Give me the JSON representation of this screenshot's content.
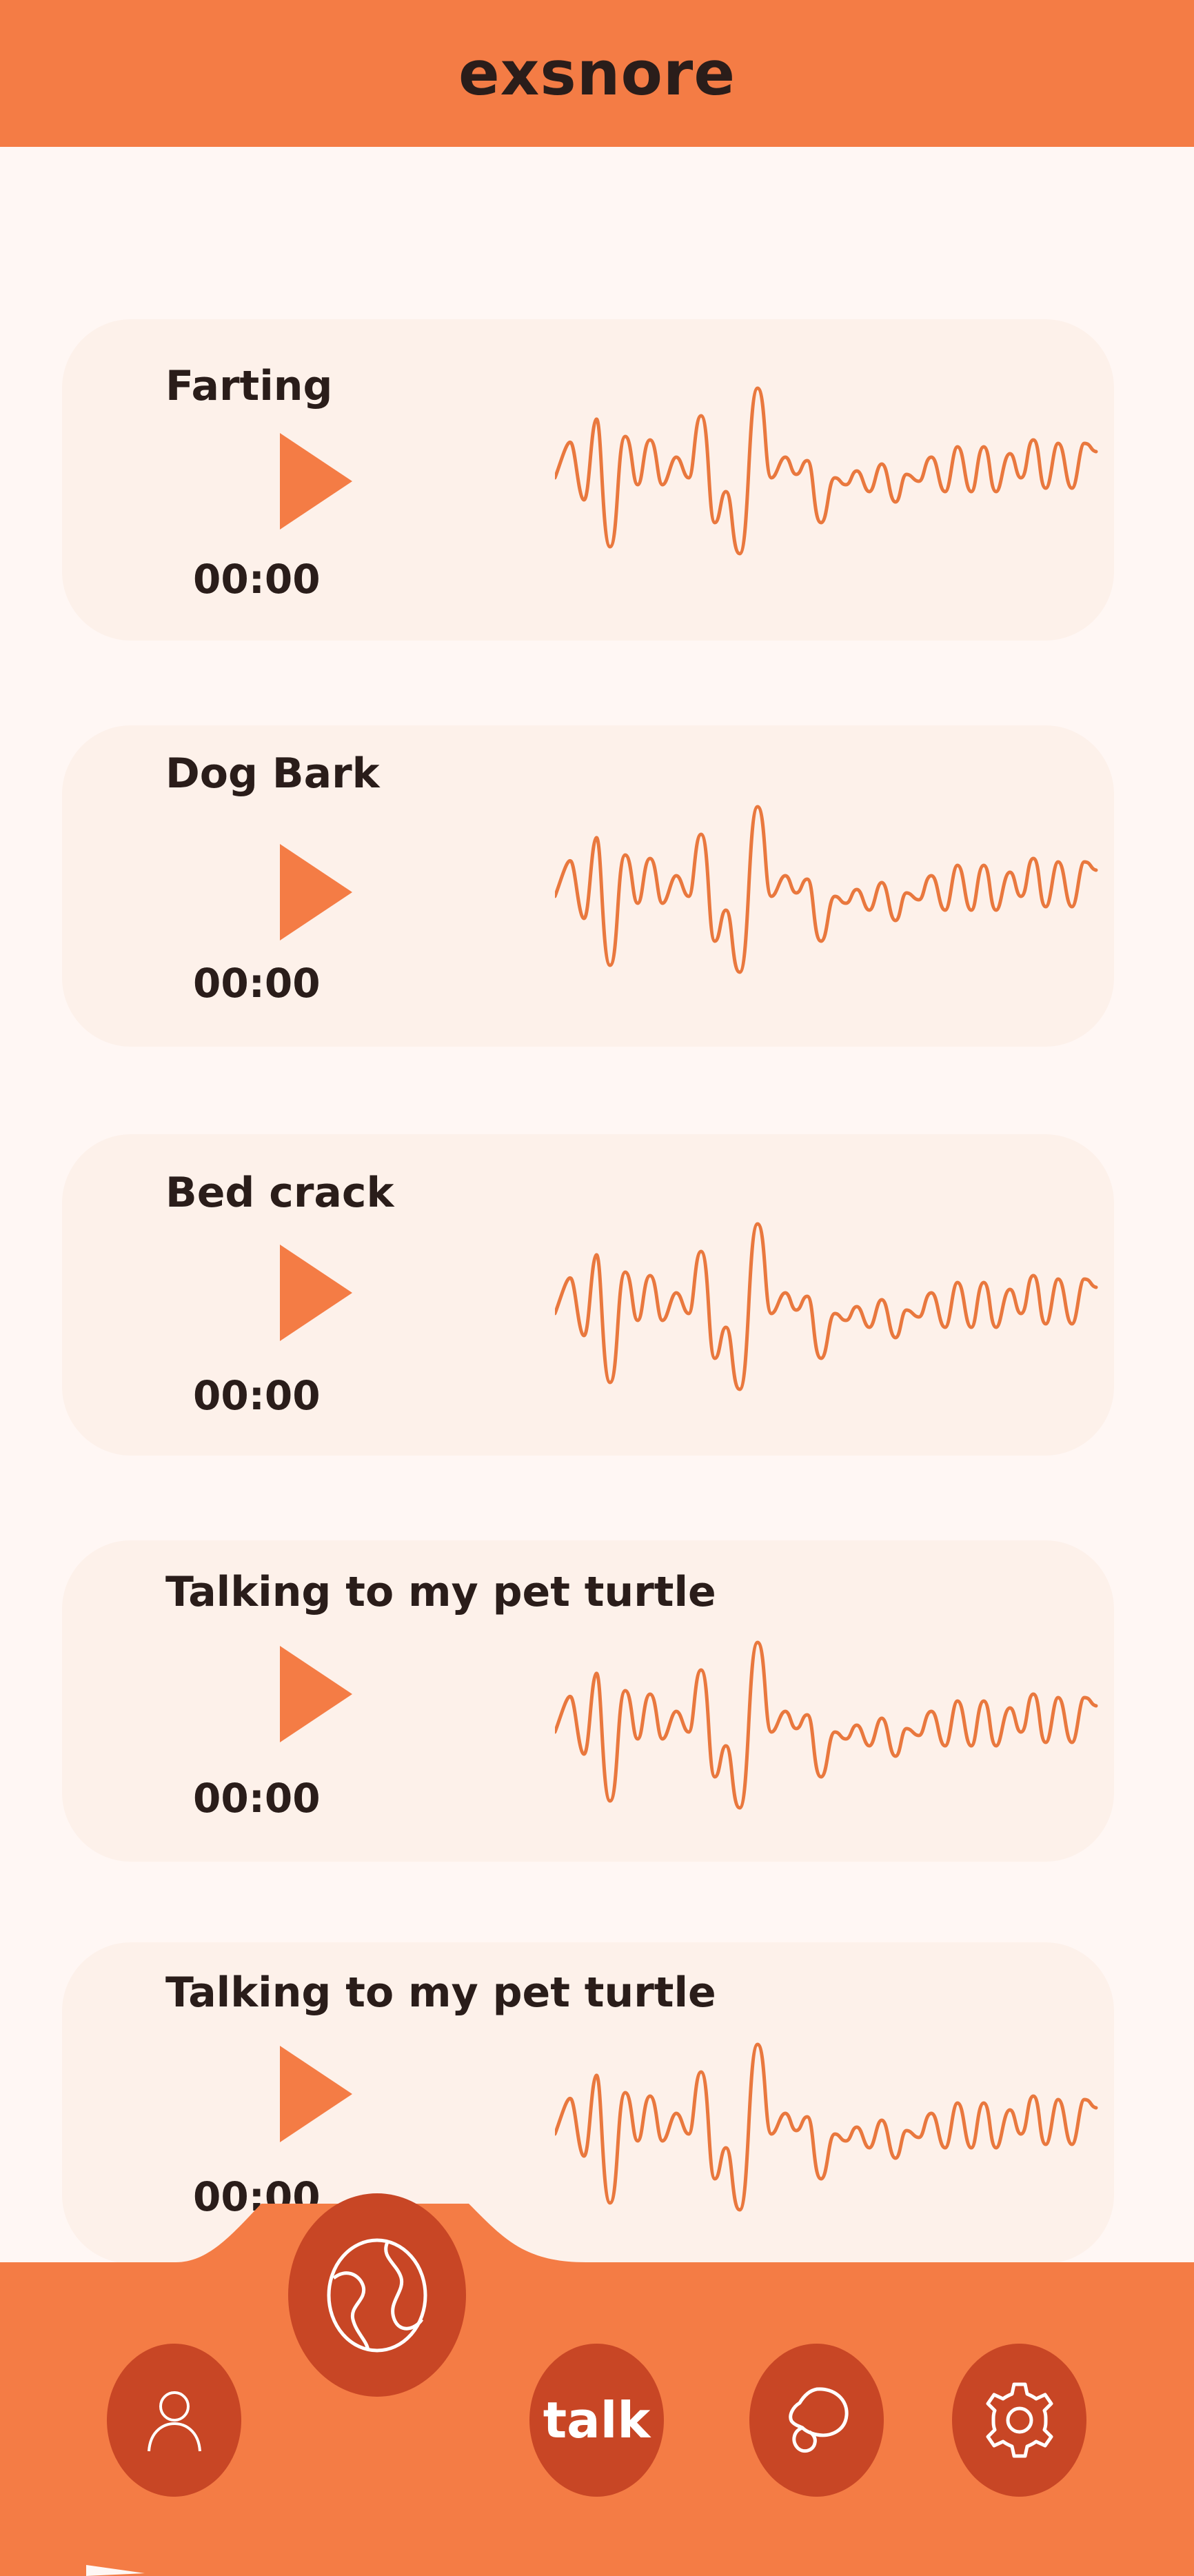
{
  "app": {
    "title": "exsnore"
  },
  "recordings": [
    {
      "title": "Farting",
      "time": "00:00"
    },
    {
      "title": "Dog Bark",
      "time": "00:00"
    },
    {
      "title": "Bed crack",
      "time": "00:00"
    },
    {
      "title": "Talking to my pet turtle",
      "time": "00:00"
    },
    {
      "title": "Talking to my pet turtle",
      "time": "00:00"
    }
  ],
  "icons": {
    "play": "play-icon",
    "waveform": "waveform-icon",
    "profile": "user-icon",
    "explore": "globe-icon",
    "chat": "chat-bubble-icon",
    "settings": "gear-icon"
  },
  "nav": {
    "talk_label": "talk"
  },
  "colors": {
    "accent": "#f47c45",
    "accent_dark": "#c84625",
    "background": "#fff7f4",
    "card": "#fdf1ea",
    "text": "#2a1d1a"
  }
}
